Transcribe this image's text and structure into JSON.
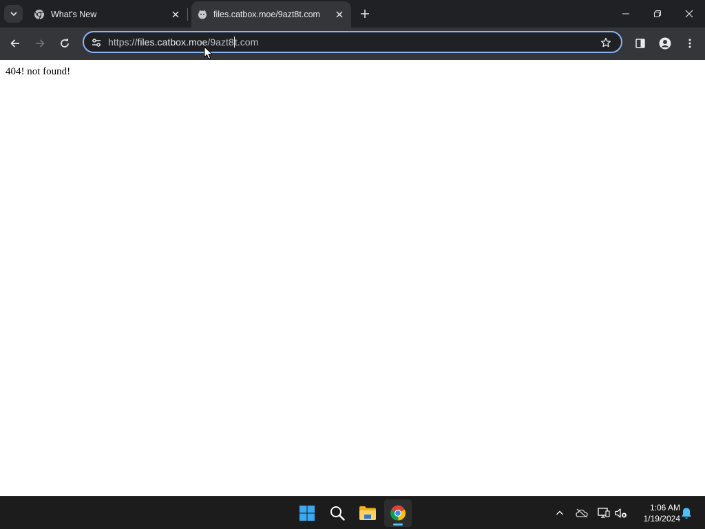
{
  "tabs": [
    {
      "title": "What's New",
      "active": false,
      "favicon": "chrome-icon"
    },
    {
      "title": "files.catbox.moe/9azt8t.com",
      "active": true,
      "favicon": "catbox-favicon"
    }
  ],
  "address_bar": {
    "scheme": "https://",
    "host": "files.catbox.moe",
    "path_before_caret": "/9azt8",
    "path_after_caret": "t.com"
  },
  "page": {
    "body_text": "404! not found!"
  },
  "taskbar": {
    "time": "1:06 AM",
    "date": "1/19/2024"
  },
  "colors": {
    "tabstrip_bg": "#202124",
    "toolbar_bg": "#35363a",
    "omnibox_focus": "#8ab4f8",
    "taskbar_bg": "#1c1c1c",
    "accent": "#4cc2ff"
  }
}
